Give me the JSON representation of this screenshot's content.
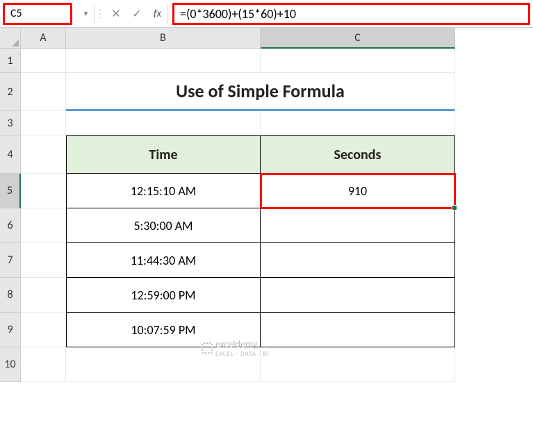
{
  "formula_bar": {
    "cell_ref": "C5",
    "fx_label": "fx",
    "formula": "=(0*3600)+(15*60)+10"
  },
  "columns": [
    "A",
    "B",
    "C"
  ],
  "rows": [
    "1",
    "2",
    "3",
    "4",
    "5",
    "6",
    "7",
    "8",
    "9",
    "10"
  ],
  "selected_col": "C",
  "selected_row": "5",
  "title": "Use of Simple Formula",
  "table": {
    "headers": {
      "time": "Time",
      "seconds": "Seconds"
    },
    "rows": [
      {
        "time": "12:15:10 AM",
        "seconds": "910"
      },
      {
        "time": "5:30:00 AM",
        "seconds": ""
      },
      {
        "time": "11:44:30 AM",
        "seconds": ""
      },
      {
        "time": "12:59:00 PM",
        "seconds": ""
      },
      {
        "time": "10:07:59 PM",
        "seconds": ""
      }
    ]
  },
  "watermark": {
    "brand": "exceldemy",
    "tagline": "EXCEL · DATA · BI"
  }
}
